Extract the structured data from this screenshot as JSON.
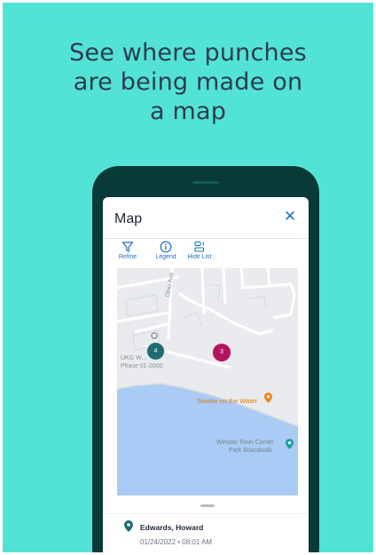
{
  "headline": {
    "line1": "See where punches",
    "line2": "are being made on",
    "line3": "a map"
  },
  "dialog": {
    "title": "Map",
    "close_icon": "close-icon"
  },
  "toolbar": {
    "refine_label": "Refine",
    "legend_label": "Legend",
    "hide_list_label": "Hide List"
  },
  "map": {
    "street_label": "Ohio Ave",
    "place_label_line1": "UKG W...",
    "place_label_line2": "Phase 01-2000",
    "poi_restaurant": "Smoke on the Water",
    "poi_park_line1": "Weston Town Center",
    "poi_park_line2": "Park Boardwalk",
    "clusters": [
      {
        "count": "4",
        "color": "#1f6b73"
      },
      {
        "count": "3",
        "color": "#b0135f"
      }
    ],
    "water_color": "#a9cbf4",
    "land_color": "#e9ebee"
  },
  "punch": {
    "name": "Edwards, Howard",
    "time": "01/24/2022 • 08:01 AM"
  },
  "colors": {
    "background": "#52e3d6",
    "phone": "#0a3a38",
    "accent": "#1e74c9"
  }
}
